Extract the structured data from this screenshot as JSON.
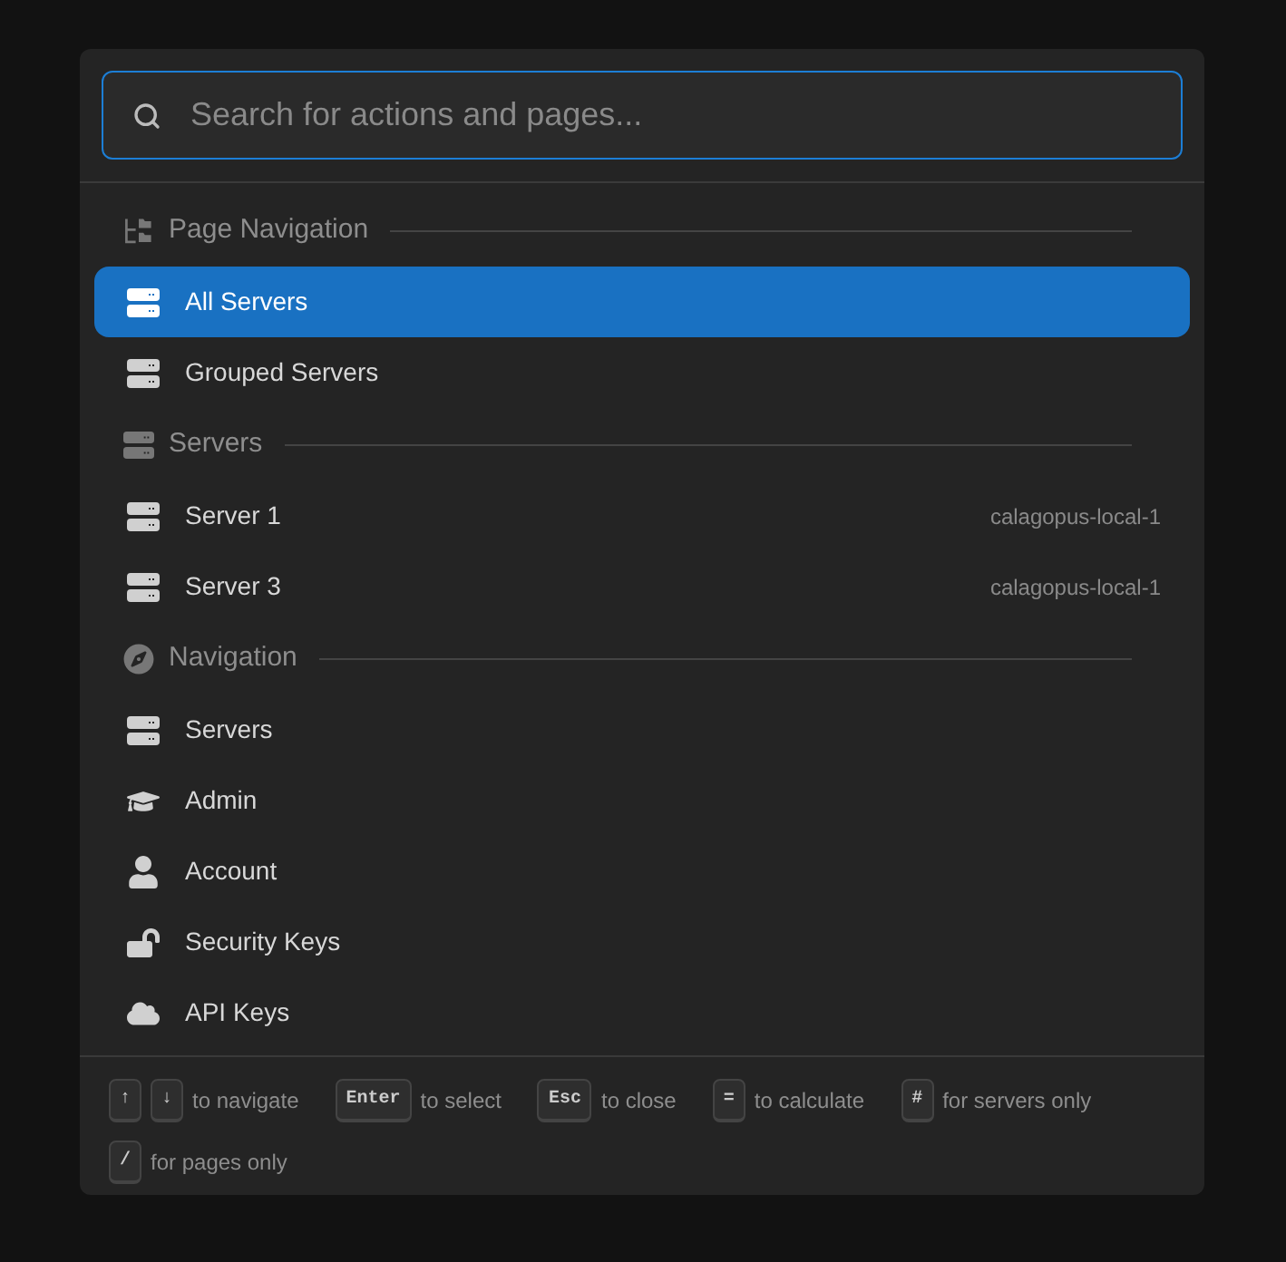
{
  "search": {
    "placeholder": "Search for actions and pages..."
  },
  "sections": [
    {
      "title": "Page Navigation",
      "kind": "tree",
      "items": [
        {
          "label": "All Servers",
          "kind": "server",
          "selected": true
        },
        {
          "label": "Grouped Servers",
          "kind": "server",
          "selected": false
        }
      ]
    },
    {
      "title": "Servers",
      "kind": "server",
      "items": [
        {
          "label": "Server 1",
          "kind": "server",
          "detail": "calagopus-local-1",
          "selected": false
        },
        {
          "label": "Server 3",
          "kind": "server",
          "detail": "calagopus-local-1",
          "selected": false
        }
      ]
    },
    {
      "title": "Navigation",
      "kind": "compass",
      "items": [
        {
          "label": "Servers",
          "kind": "server",
          "selected": false
        },
        {
          "label": "Admin",
          "kind": "cap",
          "selected": false
        },
        {
          "label": "Account",
          "kind": "user",
          "selected": false
        },
        {
          "label": "Security Keys",
          "kind": "lock",
          "selected": false
        },
        {
          "label": "API Keys",
          "kind": "cloud",
          "selected": false
        }
      ]
    }
  ],
  "hints": [
    {
      "keys": [
        "↑",
        "↓"
      ],
      "text": "to navigate"
    },
    {
      "keys": [
        "Enter"
      ],
      "text": "to select"
    },
    {
      "keys": [
        "Esc"
      ],
      "text": "to close"
    },
    {
      "keys": [
        "="
      ],
      "text": "to calculate"
    },
    {
      "keys": [
        "#"
      ],
      "text": "for servers only"
    },
    {
      "keys": [
        "/"
      ],
      "text": "for pages only"
    }
  ]
}
